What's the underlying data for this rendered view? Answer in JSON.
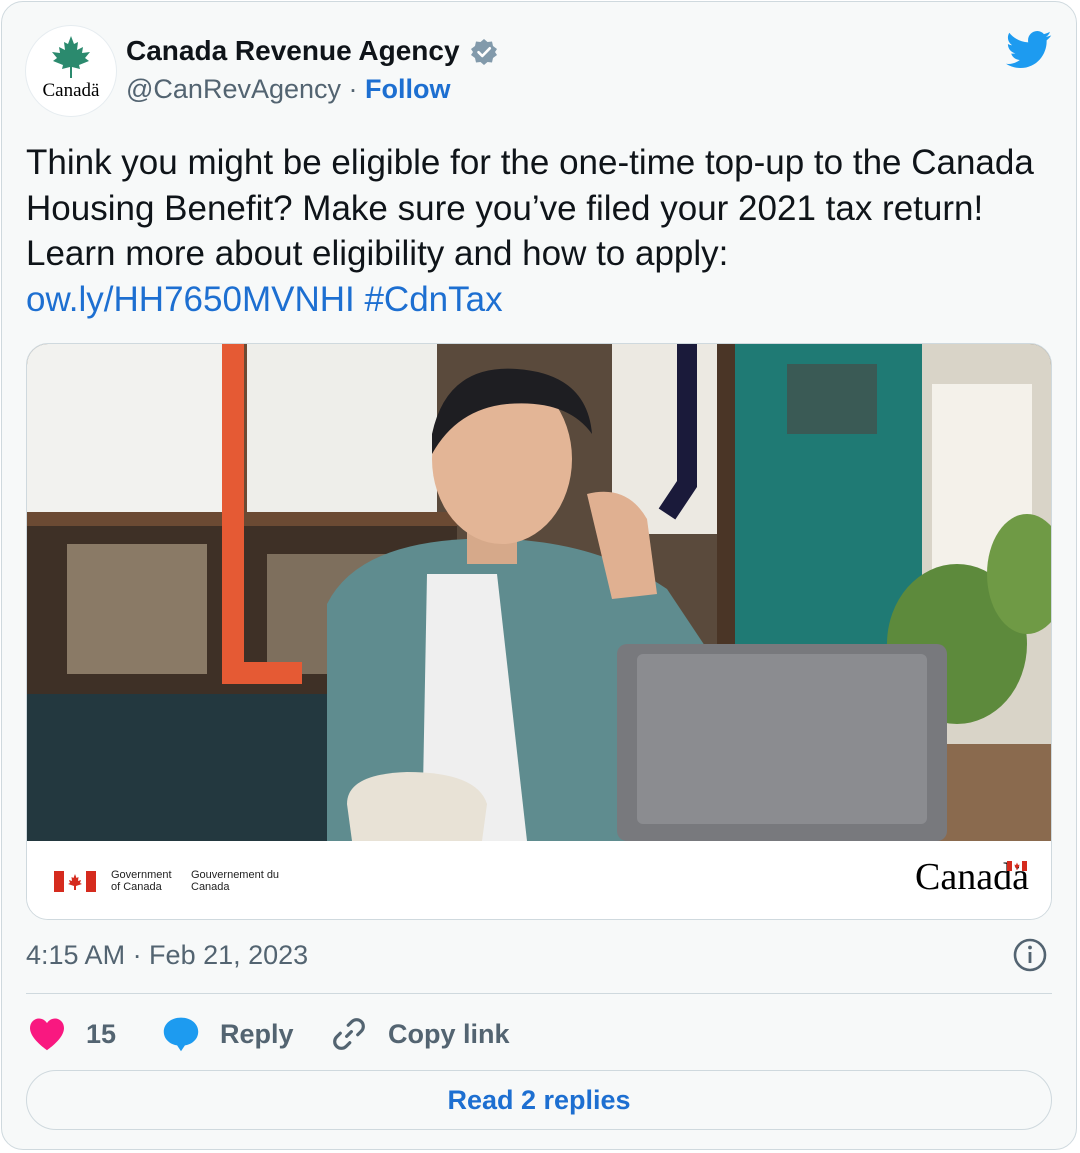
{
  "account": {
    "avatar_wordmark": "Canadä",
    "display_name": "Canada Revenue Agency",
    "handle": "@CanRevAgency",
    "separator": " · ",
    "follow_label": "Follow"
  },
  "tweet": {
    "text": "Think you might be eligible for the one-time top-up to the Canada Housing Benefit?  Make sure you’ve filed your 2021 tax return! Learn more about eligibility and how to apply: ",
    "link": "ow.ly/HH7650MVNHI",
    "hashtag": "#CdnTax"
  },
  "media": {
    "gov_en": "Government of Canada",
    "gov_fr": "Gouvernement du Canada",
    "canada_wordmark": "Canadä"
  },
  "meta": {
    "timestamp": "4:15 AM · Feb 21, 2023"
  },
  "actions": {
    "like_count": "15",
    "reply_label": "Reply",
    "copy_label": "Copy link",
    "read_replies_label": "Read 2 replies"
  },
  "colors": {
    "link_blue": "#1d6fd1",
    "like_pink": "#f91880",
    "reply_blue": "#1d9bf0",
    "twitter_blue": "#1d9bf0",
    "muted_gray": "#536471",
    "maple_green": "#2b8a6e",
    "canada_red": "#d52b1e"
  }
}
